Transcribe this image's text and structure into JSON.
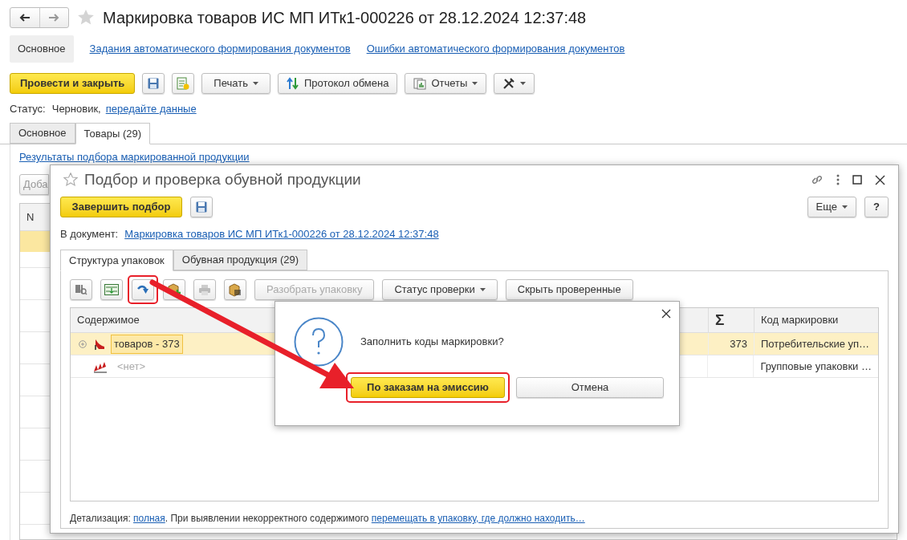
{
  "window": {
    "title": "Маркировка товаров ИС МП ИТк1-000226 от 28.12.2024 12:37:48"
  },
  "nav_tabs": [
    {
      "label": "Основное",
      "selected": true
    },
    {
      "label": "Задания автоматического формирования документов",
      "selected": false
    },
    {
      "label": "Ошибки автоматического формирования документов",
      "selected": false
    }
  ],
  "toolbar": {
    "post_button": "Провести и закрыть",
    "print_button": "Печать",
    "exchange_button": "Протокол обмена",
    "reports_button": "Отчеты"
  },
  "status": {
    "label": "Статус:",
    "value": "Черновик,",
    "link": "передайте данные"
  },
  "tabs": [
    {
      "label": "Основное",
      "selected": false
    },
    {
      "label": "Товары (29)",
      "selected": true
    }
  ],
  "goods": {
    "link": "Результаты подбора маркированной продукции",
    "add_button": "Доба",
    "column": "N"
  },
  "picker": {
    "title": "Подбор и проверка обувной продукции",
    "finish_button": "Завершить подбор",
    "more_button": "Еще",
    "help_button": "?",
    "document_label": "В документ:",
    "document_link": "Маркировка товаров ИС МП ИТк1-000226 от 28.12.2024 12:37:48",
    "tabs": [
      {
        "label": "Структура упаковок",
        "selected": true
      },
      {
        "label": "Обувная продукция (29)",
        "selected": false
      }
    ],
    "toolbar_buttons": [
      {
        "label": "Разобрать упаковку",
        "disabled": true,
        "dropdown": false
      },
      {
        "label": "Статус проверки",
        "disabled": false,
        "dropdown": true
      },
      {
        "label": "Скрыть проверенные",
        "disabled": false,
        "dropdown": false
      }
    ],
    "table": {
      "columns": [
        "Содержимое",
        "Σ",
        "Код маркировки"
      ],
      "rows": [
        {
          "content": "товаров - 373",
          "sum": "373",
          "code": "Потребительские уп…",
          "selected": true,
          "muted": false,
          "expandable": true
        },
        {
          "content": "<нет>",
          "code": "Групповые упаковки …",
          "selected": false,
          "muted": true,
          "expandable": false
        }
      ]
    },
    "footer": [
      {
        "kind": "text",
        "text": "Детализация: "
      },
      {
        "kind": "link",
        "text": "полная"
      },
      {
        "kind": "text",
        "text": ". При выявлении некорректного содержимого "
      },
      {
        "kind": "link",
        "text": "перемещать в упаковку, где должно находить…"
      }
    ]
  },
  "dialog": {
    "question": "Заполнить коды маркировки?",
    "buttons": [
      {
        "label": "По заказам на эмиссию",
        "default": true
      },
      {
        "label": "Отмена",
        "default": false
      }
    ]
  }
}
